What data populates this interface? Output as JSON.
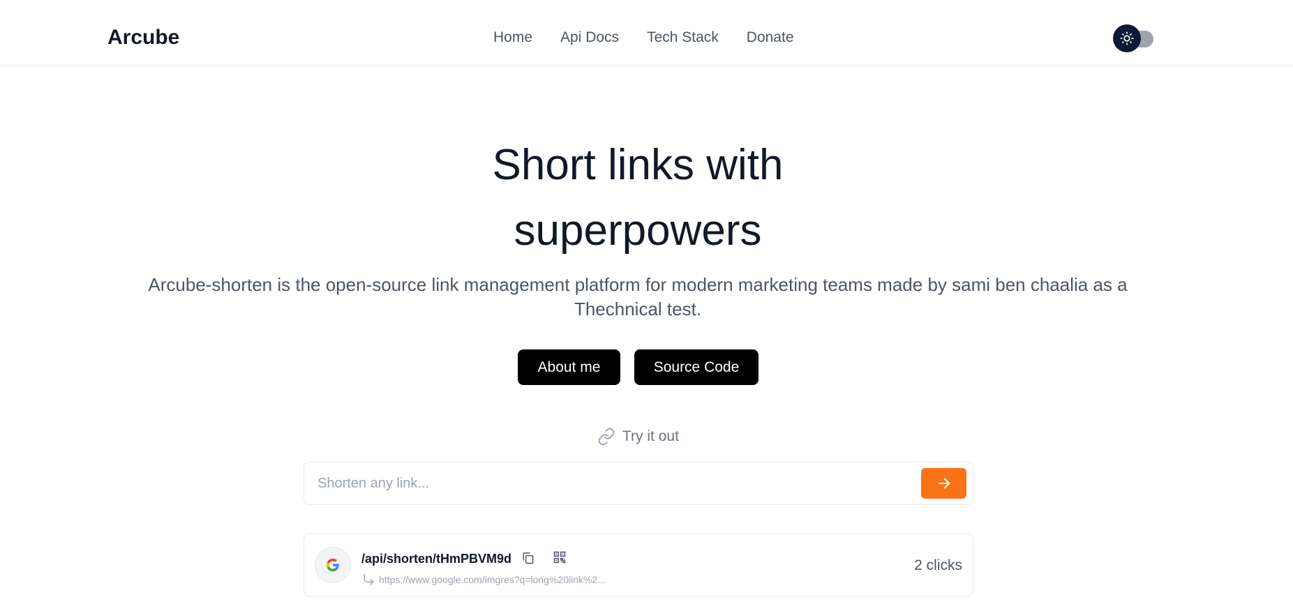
{
  "header": {
    "brand": "Arcube",
    "nav": [
      {
        "label": "Home"
      },
      {
        "label": "Api Docs"
      },
      {
        "label": "Tech Stack"
      },
      {
        "label": "Donate"
      }
    ],
    "theme_toggle_icon": "sun-icon"
  },
  "hero": {
    "title_line1": "Short links with",
    "title_line2": "superpowers",
    "description": "Arcube-shorten is the open-source link management platform for modern marketing teams made by sami ben chaalia as a Thechnical test.",
    "buttons": {
      "about": "About me",
      "source": "Source Code"
    }
  },
  "try_it": {
    "label": "Try it out",
    "icon": "link-icon"
  },
  "shorten": {
    "placeholder": "Shorten any link...",
    "value": "",
    "submit_icon": "arrow-right-icon",
    "accent_color": "#f97316"
  },
  "links": [
    {
      "favicon": "google-icon",
      "short_path": "/api/shorten/tHmPBVM9d",
      "original_url": "https://www.google.com/imgres?q=long%20link%2...",
      "clicks": "2 clicks"
    }
  ]
}
